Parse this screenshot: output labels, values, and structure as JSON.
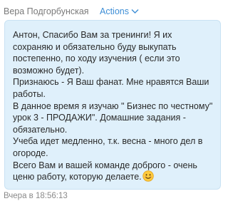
{
  "message": {
    "author": "Вера Подгорбунская",
    "actions_label": "Actions",
    "text": "Антон, Спасибо Вам за тренинги! Я их сохраняю и обязательно буду выкупать постепенно, по ходу изучения ( если это возможно будет).\nПризнаюсь - Я Ваш фанат. Мне нравятся Ваши работы.\nВ данное время я изучаю \" Бизнес по честному\" урок 3 - ПРОДАЖИ\". Домашние задания - обязательно.\nУчеба идет медленно, т.к. весна - много дел в огороде.\nВсего Вам и вашей команде доброго - очень ценю работу, которую делаете.",
    "emoji_icon": "smiling-face-icon",
    "footer": "Вчера в 18:56:13"
  },
  "colors": {
    "bubble_background": "#dff0fb",
    "link": "#3d8ed6",
    "muted_text": "#7a7a7a"
  }
}
